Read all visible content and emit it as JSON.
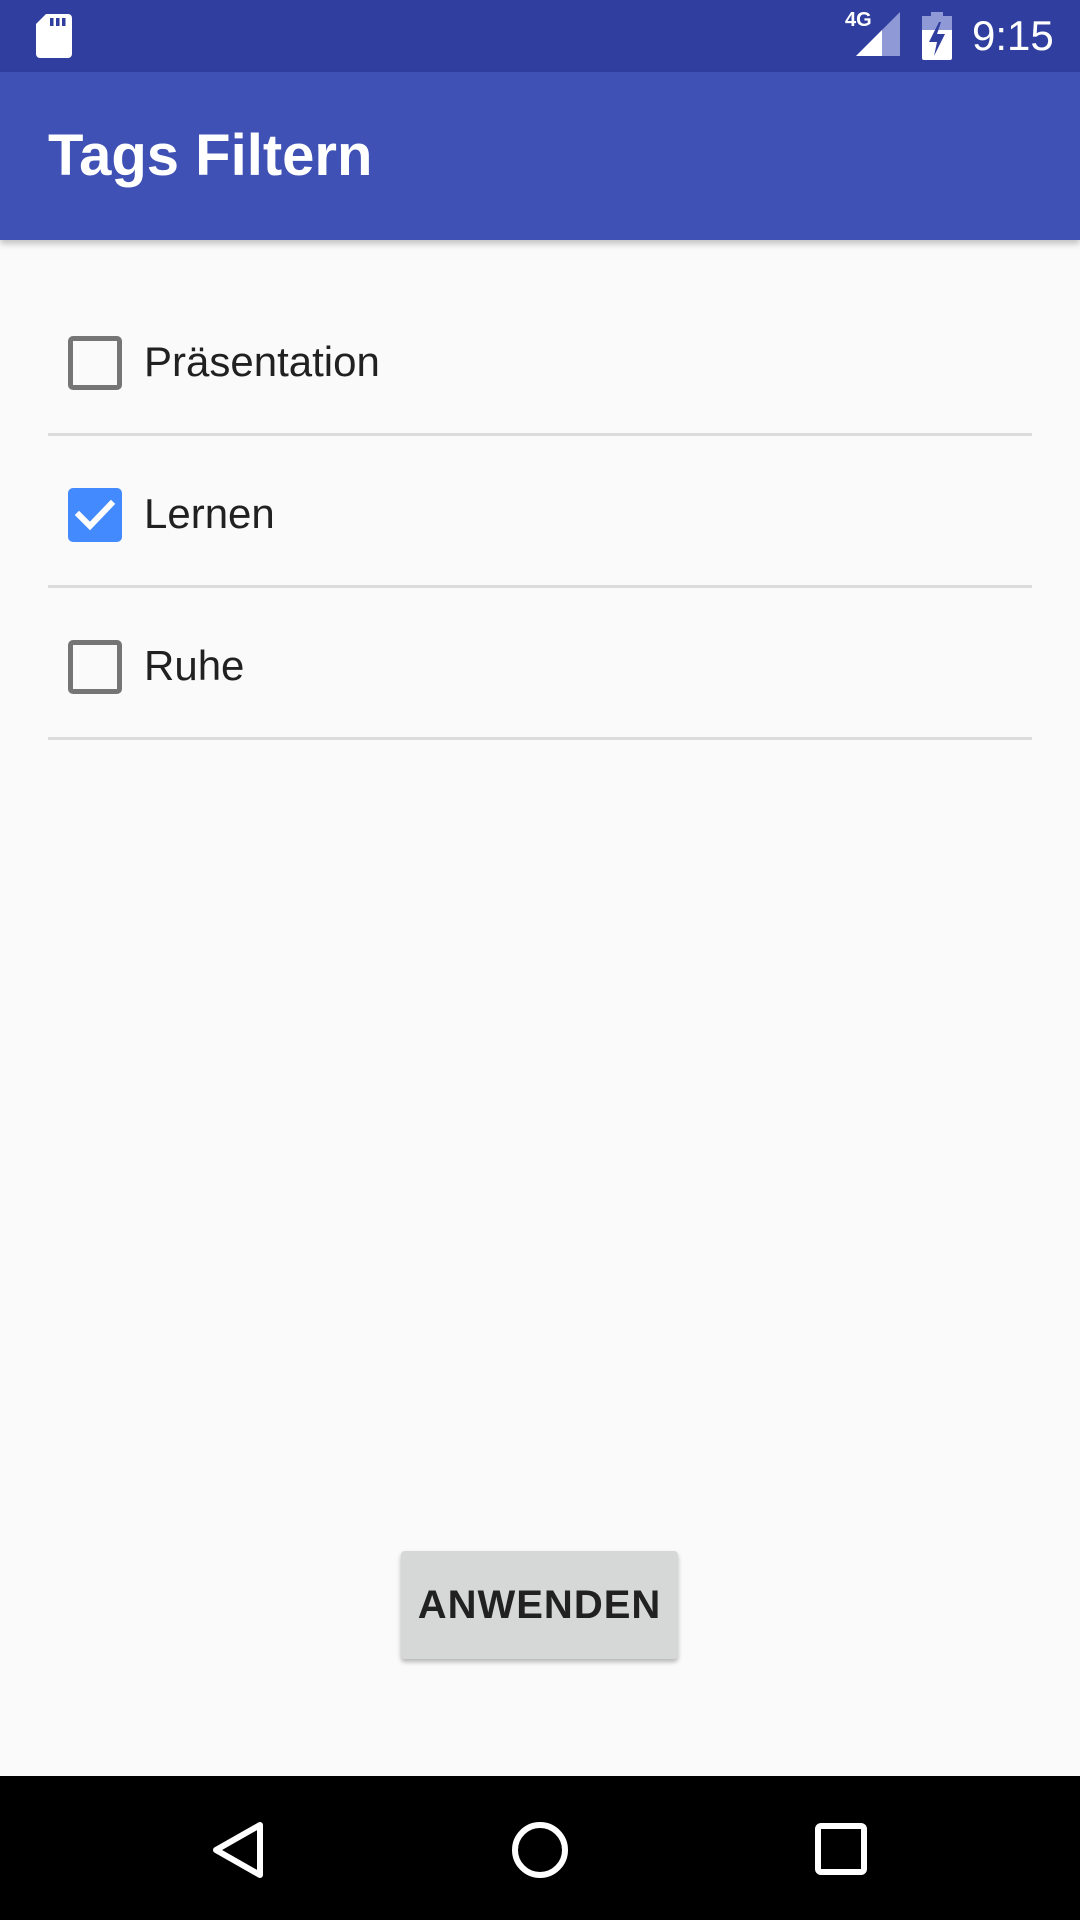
{
  "status_bar": {
    "network_type": "4G",
    "time": "9:15",
    "icons": [
      "sd-card-icon",
      "signal-icon",
      "battery-charging-icon"
    ]
  },
  "app_bar": {
    "title": "Tags Filtern",
    "background_color": "#3f51b5",
    "status_bar_color": "#303f9f"
  },
  "tags": [
    {
      "label": "Präsentation",
      "checked": false
    },
    {
      "label": "Lernen",
      "checked": true
    },
    {
      "label": "Ruhe",
      "checked": false
    }
  ],
  "checkbox_checked_color": "#448aff",
  "apply_button": {
    "label": "ANWENDEN"
  },
  "nav_bar": {
    "icons": [
      "back-icon",
      "home-icon",
      "recents-icon"
    ]
  }
}
